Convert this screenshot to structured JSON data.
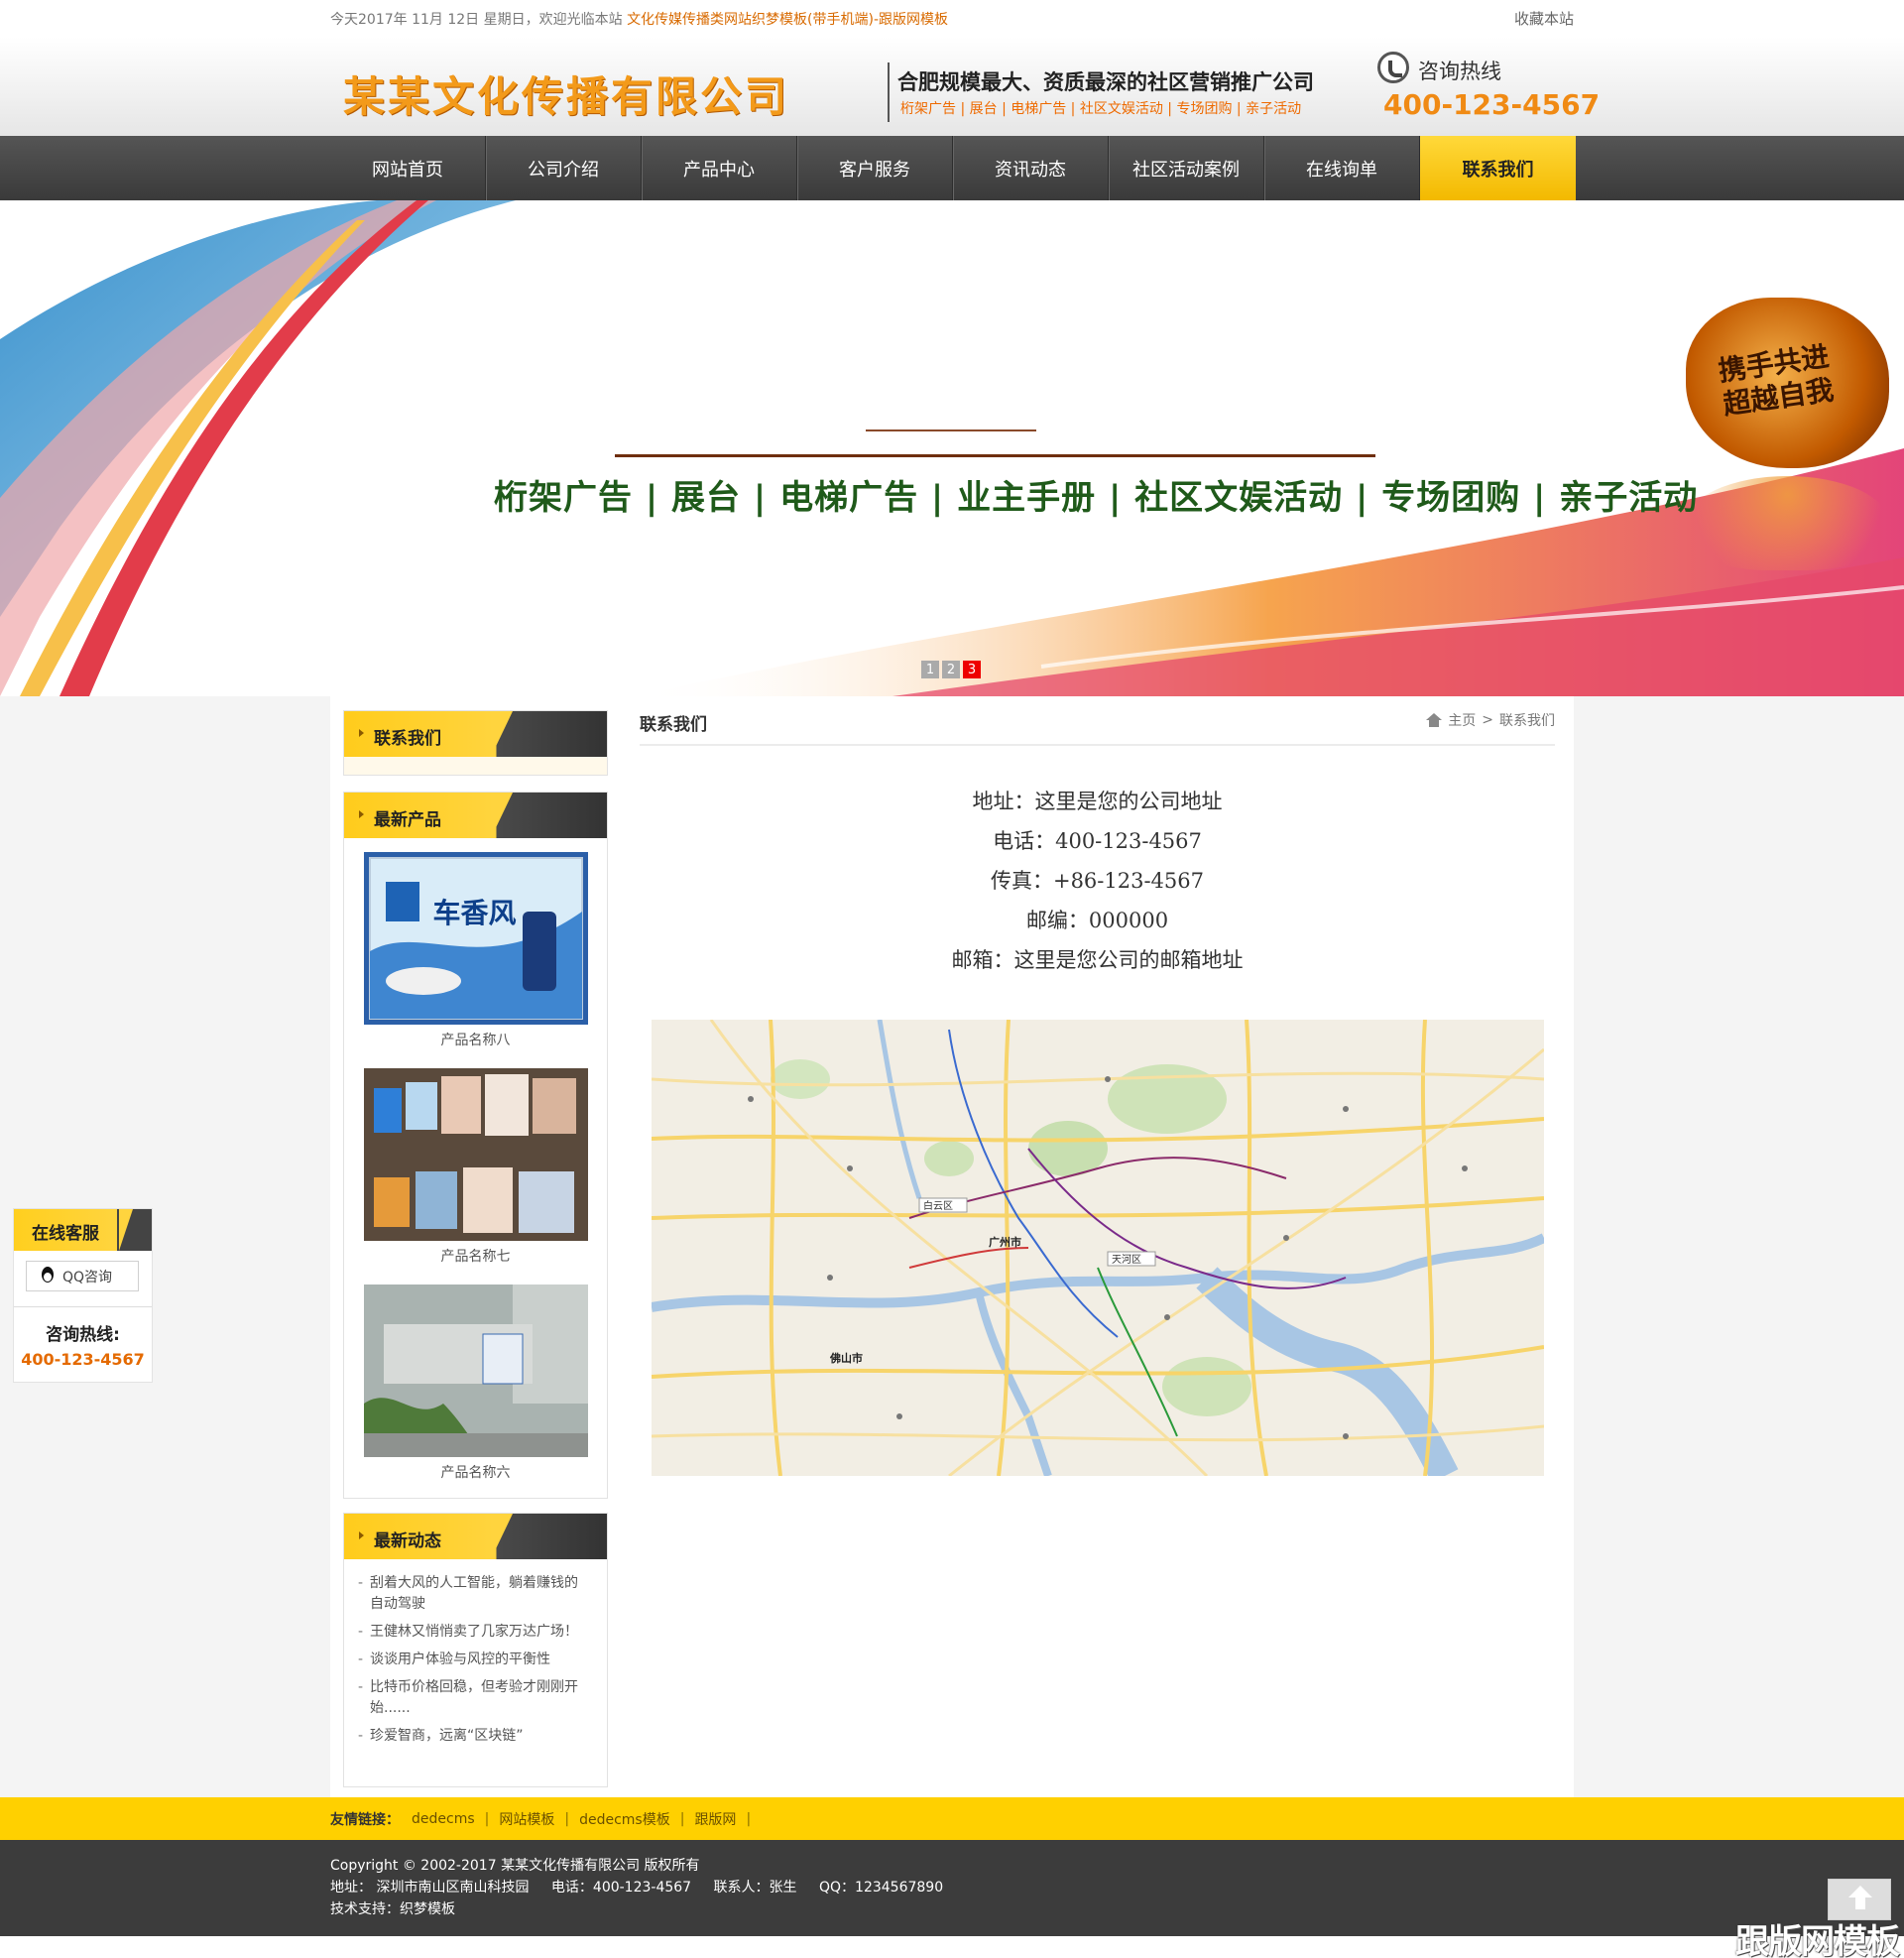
{
  "topbar": {
    "welcome": "今天2017年 11月 12日 星期日，欢迎光临本站",
    "site_link": "文化传媒传播类网站织梦模板(带手机端)-跟版网模板",
    "bookmark": "收藏本站"
  },
  "header": {
    "logo": "某某文化传播有限公司",
    "slogan": "合肥规模最大、资质最深的社区营销推广公司",
    "services": "桁架广告 | 展台 | 电梯广告 | 社区文娱活动 | 专场团购 | 亲子活动",
    "hotline_label": "咨询热线",
    "hotline_number": "400-123-4567"
  },
  "nav": {
    "items": [
      {
        "label": "网站首页"
      },
      {
        "label": "公司介绍"
      },
      {
        "label": "产品中心"
      },
      {
        "label": "客户服务"
      },
      {
        "label": "资讯动态"
      },
      {
        "label": "社区活动案例"
      },
      {
        "label": "在线询单"
      },
      {
        "label": "联系我们"
      }
    ],
    "active_index": 7
  },
  "banner": {
    "tagline": "桁架广告 | 展台 | 电梯广告 | 业主手册 | 社区文娱活动 | 专场团购 | 亲子活动",
    "stone_text_line1": "携手共进",
    "stone_text_line2": "超越自我",
    "dots": [
      "1",
      "2",
      "3"
    ],
    "active_dot": 2
  },
  "sidebar": {
    "contact_title": "联系我们",
    "products_title": "最新产品",
    "products": [
      {
        "caption": "产品名称八",
        "image_text": "车香风"
      },
      {
        "caption": "产品名称七"
      },
      {
        "caption": "产品名称六"
      }
    ],
    "news_title": "最新动态",
    "news": [
      "刮着大风的人工智能，躺着赚钱的自动驾驶",
      "王健林又悄悄卖了几家万达广场！",
      "谈谈用户体验与风控的平衡性",
      "比特币价格回稳，但考验才刚刚开始......",
      "珍爱智商，远离“区块链”"
    ]
  },
  "content": {
    "title": "联系我们",
    "breadcrumb_home": "主页",
    "breadcrumb_sep": ">",
    "breadcrumb_current": "联系我们",
    "address": "地址：这里是您的公司地址",
    "phone": "电话：400-123-4567",
    "fax": "传真：+86-123-4567",
    "zip": "邮编：000000",
    "email": "邮箱：这里是您公司的邮箱地址",
    "map_labels": {
      "city1": "广州市",
      "city2": "佛山市",
      "district": "天河区"
    }
  },
  "kefu": {
    "title": "在线客服",
    "qq": "QQ咨询",
    "hotline_label": "咨询热线:",
    "hotline_number": "400-123-4567"
  },
  "links": {
    "label": "友情链接：",
    "items": [
      "dedecms",
      "网站模板",
      "dedecms模板",
      "跟版网"
    ]
  },
  "footer": {
    "copyright": "Copyright © 2002-2017 某某文化传播有限公司 版权所有",
    "address": "地址： 深圳市南山区南山科技园",
    "phone": "电话：400-123-4567",
    "contact": "联系人：张生",
    "qq": "QQ：1234567890",
    "support": "技术支持：织梦模板"
  },
  "watermark": "跟版网模板",
  "colors": {
    "accent_yellow": "#ffd000",
    "nav_dark": "#444444",
    "orange": "#f08a14",
    "red_dot": "#ee0000"
  }
}
